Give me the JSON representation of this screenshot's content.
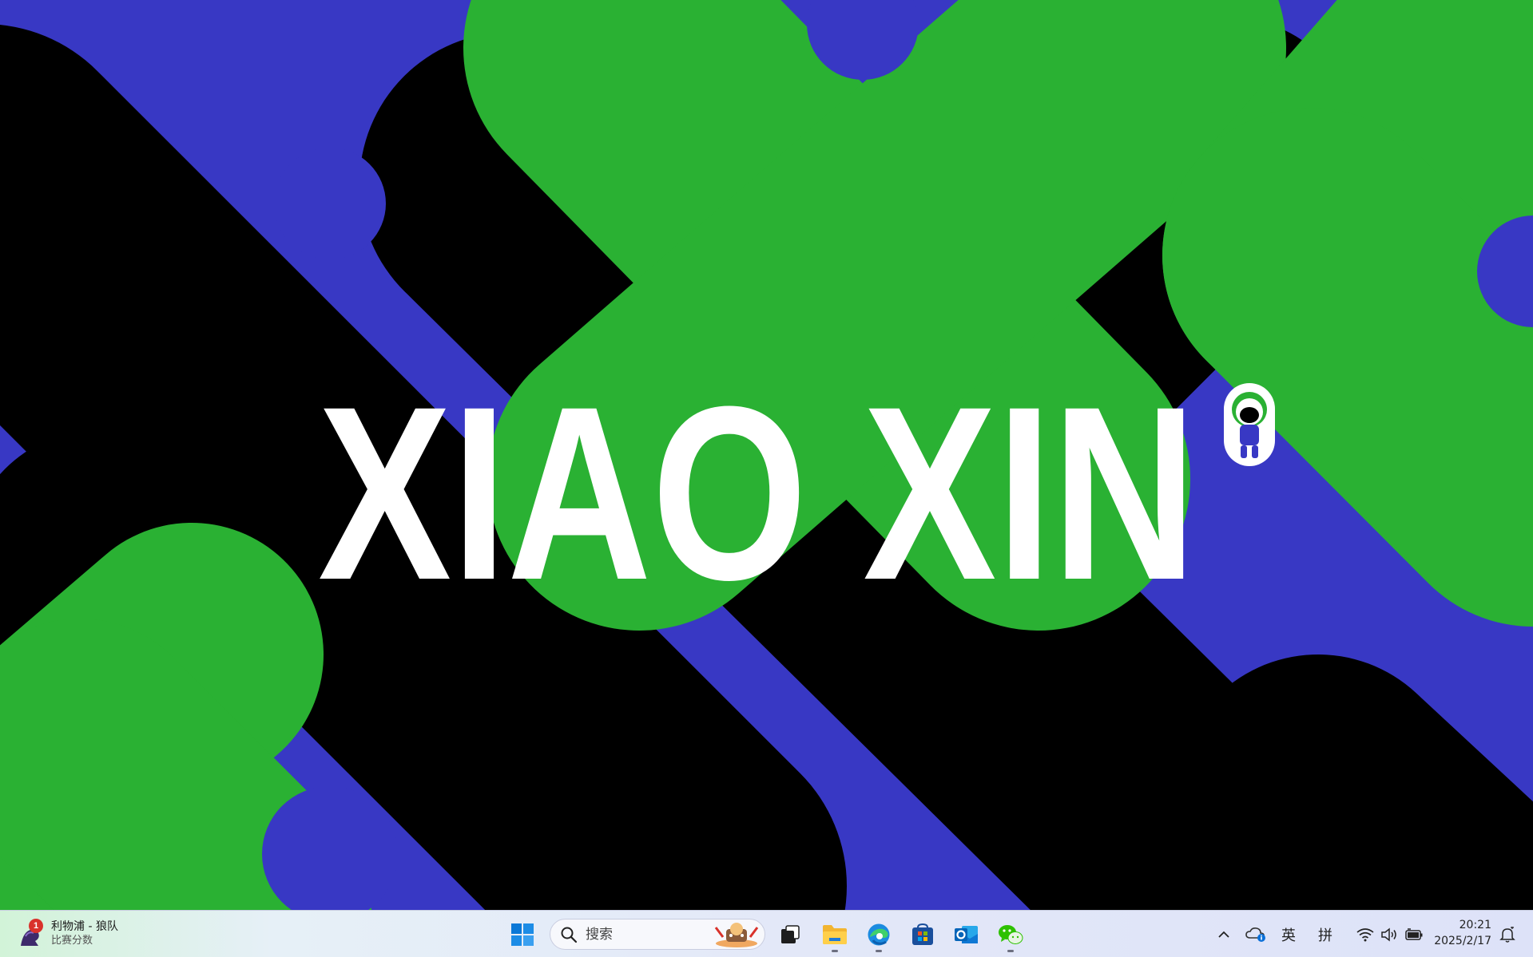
{
  "wallpaper": {
    "brand_text": "XIAO XIN",
    "colors": {
      "green": "#2ab133",
      "blue": "#3838c4",
      "black": "#000000",
      "white": "#ffffff"
    }
  },
  "taskbar": {
    "widget": {
      "badge": "1",
      "title": "利物浦 - 狼队",
      "subtitle": "比赛分数",
      "icon": "sports-widget-icon"
    },
    "start_icon": "windows-start-icon",
    "search": {
      "placeholder": "搜索"
    },
    "apps": [
      {
        "name": "task-view",
        "running": false
      },
      {
        "name": "file-explorer",
        "running": true
      },
      {
        "name": "edge",
        "running": true
      },
      {
        "name": "microsoft-store",
        "running": false
      },
      {
        "name": "outlook",
        "running": false
      },
      {
        "name": "wechat",
        "running": true
      }
    ],
    "tray": {
      "input_mode": "英",
      "ime": "拼",
      "icons": [
        "chevron-up-icon",
        "onedrive-icon",
        "wifi-icon",
        "volume-icon",
        "battery-icon",
        "notification-bell-icon"
      ]
    },
    "clock": {
      "time": "20:21",
      "date": "2025/2/17"
    }
  }
}
